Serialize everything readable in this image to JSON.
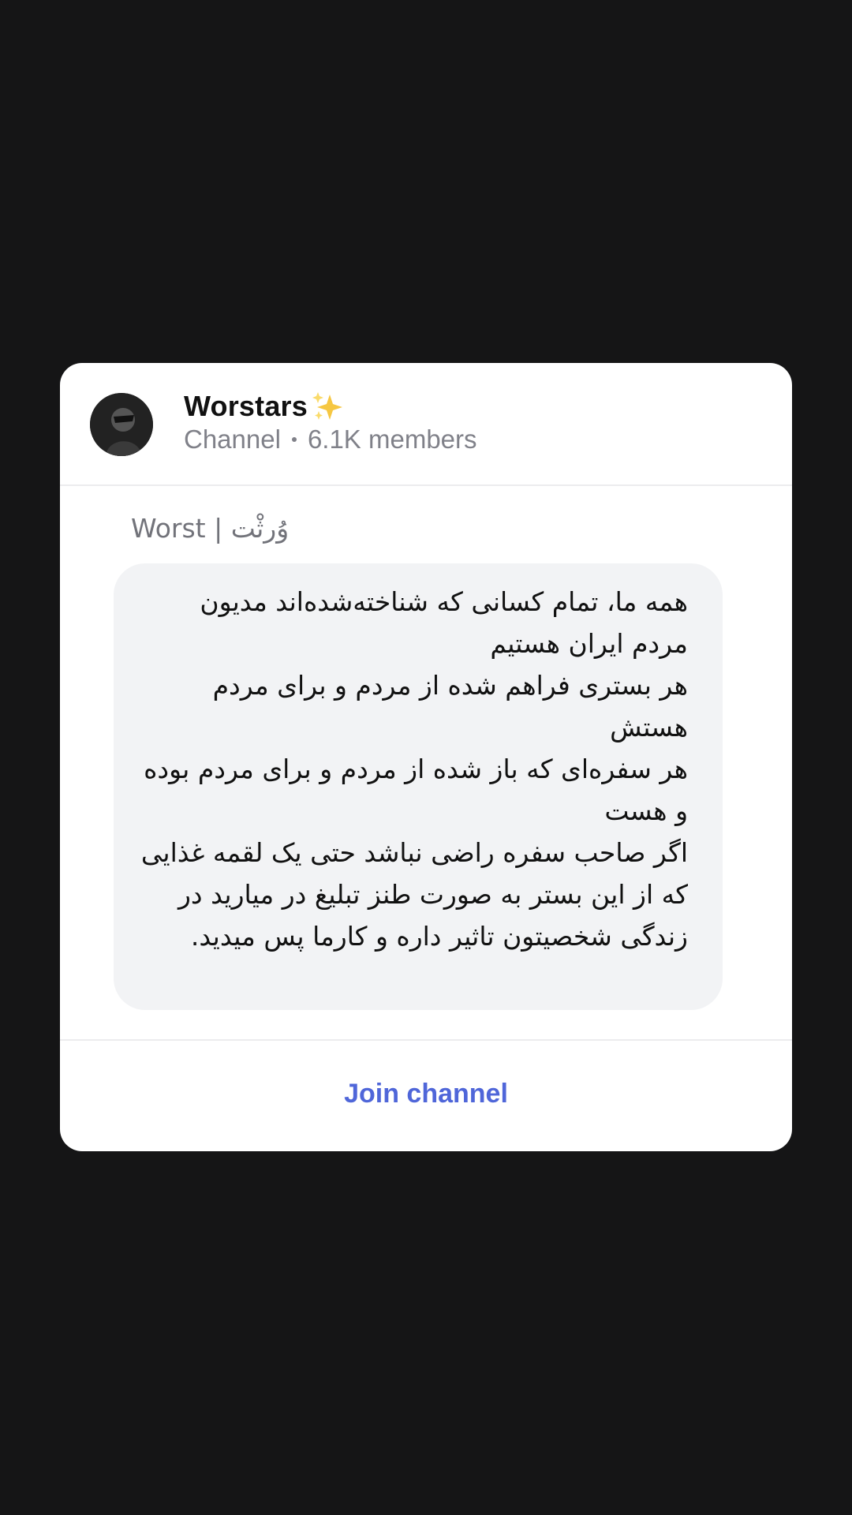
{
  "channel": {
    "name": "Worstars",
    "type_label": "Channel",
    "members": "6.1K members"
  },
  "post": {
    "author": "Worst | وُرثْت",
    "text": "همه ما، تمام کسانی که شناخته‌شده‌اند مدیون مردم ایران هستیم\nهر بستری فراهم شده از مردم و برای مردم هستش\nهر سفره‌ای که باز شده از مردم و برای مردم بوده و هست\nاگر صاحب سفره راضی نباشد حتی یک لقمه غذایی که از این بستر به صورت طنز تبلیغ در میارید در زندگی شخصیتون تاثیر داره و کارما پس میدید."
  },
  "actions": {
    "join_label": "Join channel"
  },
  "colors": {
    "background": "#151516",
    "card": "#ffffff",
    "bubble": "#f2f3f5",
    "accent": "#4f66d9",
    "muted": "#808189"
  },
  "icons": {
    "title_emoji": "sparkles-icon"
  }
}
